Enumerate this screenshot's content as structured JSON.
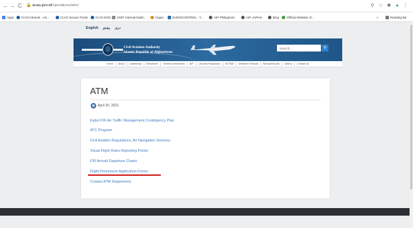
{
  "browser": {
    "url_host": "acaa.gov.af",
    "url_path": "/operations/atm/",
    "nav_icons": [
      "←",
      "→",
      "C"
    ],
    "right_icons": [
      "⚲",
      "☆",
      "✱",
      "●",
      "⋮"
    ],
    "bookmarks": [
      {
        "label": "Apps",
        "color": "#4285f4"
      },
      {
        "label": "ICAO Intranet - Ho...",
        "color": "#1a5ba8"
      },
      {
        "label": "ICAO Secure Portal",
        "color": "#1a5ba8"
      },
      {
        "label": "ICAO iKNC",
        "color": "#1a5ba8"
      },
      {
        "label": "CMIT Internal Dash...",
        "color": "#8a8a8a"
      },
      {
        "label": "Cigna",
        "color": "#e08a1e"
      },
      {
        "label": "EUROCONTROL - T...",
        "color": "#2a6fb3"
      },
      {
        "label": "AIP-Philippines",
        "color": "#555555"
      },
      {
        "label": "AIP-JAPAN",
        "color": "#555555"
      },
      {
        "label": "Bing",
        "color": "#555555"
      },
      {
        "label": "Official Website of...",
        "color": "#3a9a3a"
      }
    ],
    "reading_list": "Reading list",
    "reading_close": "»"
  },
  "site": {
    "languages": [
      "English",
      "پښتو",
      "دری"
    ],
    "org_title": "Civil Aviation Authority",
    "org_subtitle": "Islamic Republic of Afghanistan",
    "search_placeholder": "Search...",
    "search_icon": "magnifier-icon",
    "nav": [
      "Home",
      "About",
      "Leadership",
      "Directories",
      "General Information",
      "AIP",
      "Law And Regulation",
      "NOTAM",
      "Weather Forecast",
      "News&Reports",
      "Gallery",
      "Contact Us"
    ]
  },
  "content": {
    "title": "ATM",
    "date": "April 20, 2021",
    "links": [
      "Kabul FIR Air Traffic Management Contingency Plan",
      "ATC Program",
      "Civil Aviation Regulations, Air Navigation Services",
      "Visual Flight Rules Reporting Points",
      "FIR Arrival/ Departure Charts",
      "Flight Permission Application Forms",
      "Contact ATM Department"
    ]
  },
  "colors": {
    "link": "#3f7cc1",
    "banner": "#2c6aa0",
    "highlight": "#d21c1c"
  }
}
